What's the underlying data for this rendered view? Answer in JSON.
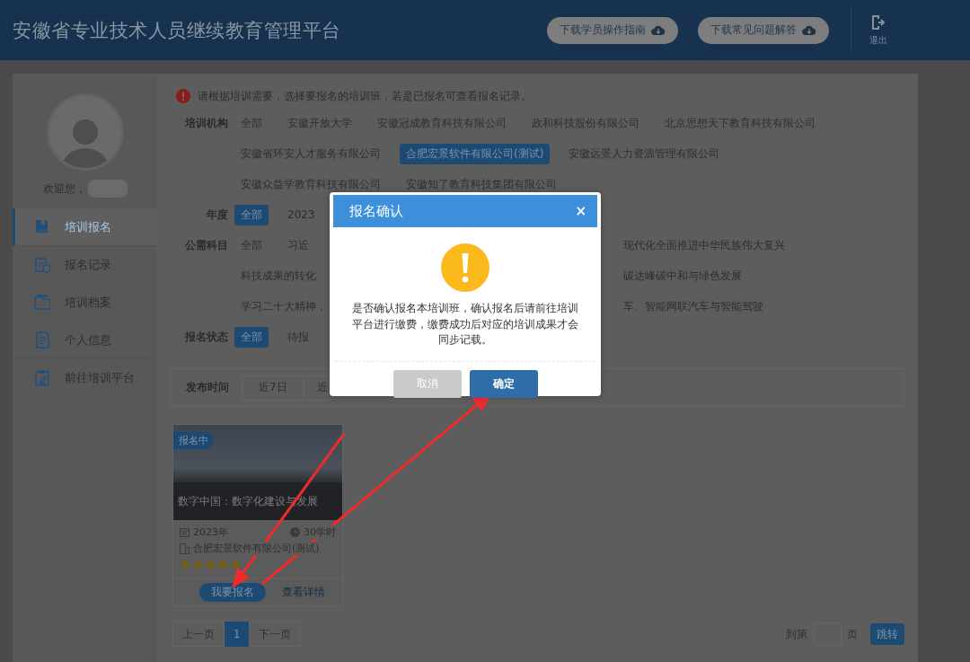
{
  "header": {
    "title": "安徽省专业技术人员继续教育管理平台",
    "buttons": [
      "下载学员操作指南",
      "下载常见问题解答"
    ],
    "logout": "退出"
  },
  "sidebar": {
    "welcome": "欢迎您，",
    "items": [
      {
        "label": "培训报名",
        "kind": "book",
        "selected": true
      },
      {
        "label": "报名记录",
        "kind": "record",
        "selected": false
      },
      {
        "label": "培训档案",
        "kind": "folder",
        "selected": false
      },
      {
        "label": "个人信息",
        "kind": "document",
        "selected": false
      },
      {
        "label": "前往培训平台",
        "kind": "clipboard",
        "selected": false
      }
    ]
  },
  "notice": "请根据培训需要，选择要报名的培训班，若是已报名可查看报名记录。",
  "filters": [
    {
      "label": "培训机构",
      "rows": [
        {
          "options": [
            {
              "label": "全部",
              "selected": false
            },
            {
              "label": "安徽开放大学",
              "selected": false
            },
            {
              "label": "安徽冠成教育科技有限公司",
              "selected": false
            },
            {
              "label": "政和科技股份有限公司",
              "selected": false
            },
            {
              "label": "北京思想天下教育科技有限公司",
              "selected": false
            }
          ]
        },
        {
          "options": [
            {
              "label": "安徽省环安人才服务有限公司",
              "selected": false
            },
            {
              "label": "合肥宏景软件有限公司(测试)",
              "selected": true
            },
            {
              "label": "安徽远景人力资源管理有限公司",
              "selected": false
            }
          ]
        },
        {
          "options": [
            {
              "label": "安徽众益学教育科技有限公司",
              "selected": false
            },
            {
              "label": "安徽知了教育科技集团有限公司",
              "selected": false
            }
          ]
        }
      ]
    },
    {
      "label": "年度",
      "rows": [
        {
          "options": [
            {
              "label": "全部",
              "selected": true
            },
            {
              "label": "2023",
              "selected": false
            }
          ]
        }
      ]
    },
    {
      "label": "公需科目",
      "rows": [
        {
          "options": [
            {
              "label": "全部",
              "selected": false
            },
            {
              "label": "习近",
              "selected": false
            }
          ],
          "options_after_dialog": [
            {
              "label": "现代化全面推进中华民族伟大复兴",
              "selected": false
            }
          ]
        },
        {
          "options": [
            {
              "label": "科技成果的转化",
              "selected": false
            }
          ],
          "options_after_dialog": [
            {
              "label": "碳达峰碳中和与绿色发展",
              "selected": false
            }
          ]
        },
        {
          "options": [
            {
              "label": "学习二十大精神，",
              "selected": false
            }
          ],
          "options_after_dialog": [
            {
              "label": "车、智能网联汽车与智能驾驶",
              "selected": false
            }
          ]
        }
      ]
    },
    {
      "label": "报名状态",
      "rows": [
        {
          "options": [
            {
              "label": "全部",
              "selected": true
            },
            {
              "label": "待报",
              "selected": false
            }
          ]
        }
      ]
    }
  ],
  "publish_time": {
    "label": "发布时间",
    "options": [
      {
        "label": "近7日",
        "selected": false
      },
      {
        "label": "近",
        "selected": false
      }
    ]
  },
  "course": {
    "badge": "报名中",
    "title": "数字中国：数字化建设与发展",
    "year": "2023年",
    "hours": "30学时",
    "provider": "合肥宏景软件有限公司(测试)",
    "stars": 5,
    "enroll_button": "我要报名",
    "details_link": "查看详情"
  },
  "pagination": {
    "prev": "上一页",
    "pages": [
      {
        "label": "1",
        "selected": true
      }
    ],
    "next": "下一页",
    "goto_before": "到第",
    "goto_after": "页",
    "goto_button": "跳转"
  },
  "dialog": {
    "title": "报名确认",
    "close": "×",
    "message": "是否确认报名本培训班，确认报名后请前往培训平台进行缴费，缴费成功后对应的培训成果才会同步记载。",
    "cancel": "取消",
    "cancel_disabled": true,
    "confirm": "确定"
  }
}
